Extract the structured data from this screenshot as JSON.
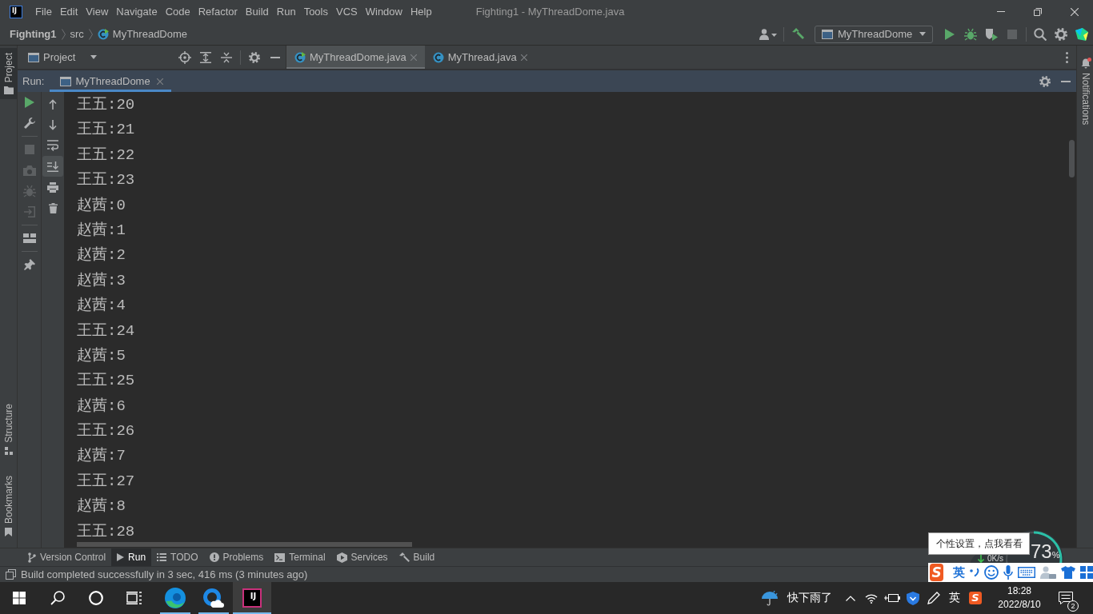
{
  "title_bar": {
    "logo": "IJ",
    "menu": [
      "File",
      "Edit",
      "View",
      "Navigate",
      "Code",
      "Refactor",
      "Build",
      "Run",
      "Tools",
      "VCS",
      "Window",
      "Help"
    ],
    "title": "Fighting1 - MyThreadDome.java"
  },
  "nav_bar": {
    "breadcrumbs": [
      {
        "label": "Fighting1",
        "kind": "project"
      },
      {
        "label": "src",
        "kind": "folder"
      },
      {
        "label": "MyThreadDome",
        "kind": "class"
      }
    ],
    "run_config": "MyThreadDome"
  },
  "left_stripe": [
    {
      "label": "Project",
      "kind": "project",
      "selected": true
    },
    {
      "label": "Structure",
      "kind": "structure",
      "selected": false
    },
    {
      "label": "Bookmarks",
      "kind": "bookmarks",
      "selected": false
    }
  ],
  "right_stripe": {
    "label": "Notifications",
    "unread": true
  },
  "project_panel": {
    "title": "Project"
  },
  "editor_tabs": [
    {
      "label": "MyThreadDome.java",
      "kind": "runnable",
      "selected": true
    },
    {
      "label": "MyThread.java",
      "kind": "class",
      "selected": false
    }
  ],
  "run_window": {
    "label": "Run:",
    "tabs": [
      {
        "label": "MyThreadDome",
        "selected": true
      }
    ],
    "actions": [
      {
        "kind": "rerun",
        "disabled": false
      },
      {
        "kind": "settings",
        "disabled": false
      },
      {
        "kind": "separator"
      },
      {
        "kind": "stop",
        "disabled": true
      },
      {
        "kind": "dump",
        "disabled": true
      },
      {
        "kind": "debug",
        "disabled": true
      },
      {
        "kind": "exit",
        "disabled": true
      },
      {
        "kind": "separator"
      },
      {
        "kind": "layout",
        "disabled": false
      },
      {
        "kind": "separator"
      },
      {
        "kind": "pin",
        "disabled": false
      }
    ],
    "console_actions": [
      {
        "kind": "up",
        "on": false
      },
      {
        "kind": "down",
        "on": false
      },
      {
        "kind": "wrap",
        "on": false
      },
      {
        "kind": "scroll_end",
        "on": true
      },
      {
        "kind": "print",
        "on": false
      },
      {
        "kind": "clear",
        "on": false
      }
    ],
    "lines": [
      "王五:20",
      "王五:21",
      "王五:22",
      "王五:23",
      "赵茜:0",
      "赵茜:1",
      "赵茜:2",
      "赵茜:3",
      "赵茜:4",
      "王五:24",
      "赵茜:5",
      "王五:25",
      "赵茜:6",
      "王五:26",
      "赵茜:7",
      "王五:27",
      "赵茜:8",
      "王五:28"
    ]
  },
  "tool_window_bar": [
    {
      "label": "Version Control",
      "kind": "vcs",
      "selected": false
    },
    {
      "label": "Run",
      "kind": "run",
      "selected": true
    },
    {
      "label": "TODO",
      "kind": "todo",
      "selected": false
    },
    {
      "label": "Problems",
      "kind": "problems",
      "selected": false
    },
    {
      "label": "Terminal",
      "kind": "terminal",
      "selected": false
    },
    {
      "label": "Services",
      "kind": "services",
      "selected": false
    },
    {
      "label": "Build",
      "kind": "build",
      "selected": false
    }
  ],
  "status_bar": {
    "message": "Build completed successfully in 3 sec, 416 ms (3 minutes ago)"
  },
  "taskbar": {
    "apps": [
      {
        "kind": "edge",
        "selected": false
      },
      {
        "kind": "cloud",
        "selected": false
      },
      {
        "kind": "intellij",
        "label": "IJ",
        "selected": true
      }
    ],
    "weather": "快下雨了",
    "input_mode": "英",
    "ime_logo": "S",
    "time": "18:28",
    "date": "2022/8/10",
    "notifications": "2"
  },
  "speed_widget": {
    "percent": "73",
    "unit": "%",
    "rate": "0K/s"
  },
  "ime_tooltip": "个性设置，点我看看",
  "ime_toolbar": {
    "logo": "S",
    "mode": "英"
  }
}
